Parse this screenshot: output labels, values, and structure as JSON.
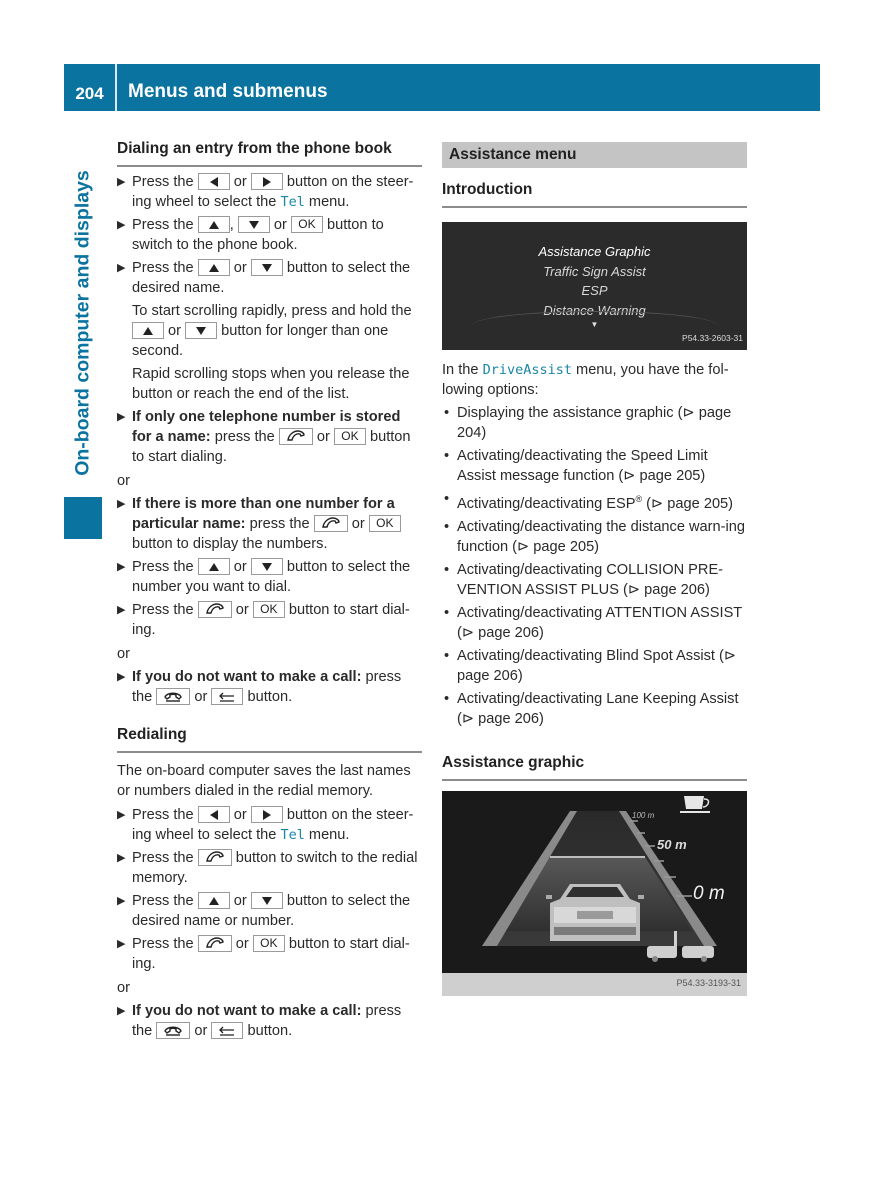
{
  "header": {
    "page_number": "204",
    "title": "Menus and submenus"
  },
  "side_tab": {
    "label": "On-board computer and displays"
  },
  "left": {
    "section1": {
      "title": "Dialing an entry from the phone book",
      "items": [
        {
          "type": "step",
          "parts": [
            "Press the ",
            "[left]",
            " or ",
            "[right]",
            " button on the steer-ing wheel to select the ",
            "{Tel}",
            " menu."
          ]
        },
        {
          "type": "step",
          "parts": [
            "Press the ",
            "[up]",
            ", ",
            "[down]",
            " or ",
            "[OK]",
            " button to switch to the phone book."
          ]
        },
        {
          "type": "step",
          "parts": [
            "Press the ",
            "[up]",
            " or ",
            "[down]",
            " button to select the desired name."
          ]
        },
        {
          "type": "note",
          "parts": [
            "To start scrolling rapidly, press and hold the ",
            "[up]",
            " or ",
            "[down]",
            " button for longer than one second."
          ]
        },
        {
          "type": "note",
          "parts": [
            "Rapid scrolling stops when you release the button or reach the end of the list."
          ]
        },
        {
          "type": "step",
          "bold": "If only one telephone number is stored for a name:",
          "parts": [
            " press the ",
            "[phone]",
            " or ",
            "[OK]",
            " button to start dialing."
          ]
        },
        {
          "type": "or",
          "text": "or"
        },
        {
          "type": "step",
          "bold": "If there is more than one number for a particular name:",
          "parts": [
            " press the ",
            "[phone]",
            " or ",
            "[OK]",
            " button to display the numbers."
          ]
        },
        {
          "type": "step",
          "parts": [
            "Press the ",
            "[up]",
            " or ",
            "[down]",
            " button to select the number you want to dial."
          ]
        },
        {
          "type": "step",
          "parts": [
            "Press the ",
            "[phone]",
            " or ",
            "[OK]",
            " button to start dial-ing."
          ]
        },
        {
          "type": "or",
          "text": "or"
        },
        {
          "type": "step",
          "bold": "If you do not want to make a call:",
          "parts": [
            " press the ",
            "[hangup]",
            " or ",
            "[back]",
            " button."
          ]
        }
      ]
    },
    "section2": {
      "title": "Redialing",
      "intro": "The on-board computer saves the last names or numbers dialed in the redial memory.",
      "items": [
        {
          "type": "step",
          "parts": [
            "Press the ",
            "[left]",
            " or ",
            "[right]",
            " button on the steer-ing wheel to select the ",
            "{Tel}",
            " menu."
          ]
        },
        {
          "type": "step",
          "parts": [
            "Press the ",
            "[phone]",
            " button to switch to the redial memory."
          ]
        },
        {
          "type": "step",
          "parts": [
            "Press the ",
            "[up]",
            " or ",
            "[down]",
            " button to select the desired name or number."
          ]
        },
        {
          "type": "step",
          "parts": [
            "Press the ",
            "[phone]",
            " or ",
            "[OK]",
            " button to start dial-ing."
          ]
        },
        {
          "type": "or",
          "text": "or"
        },
        {
          "type": "step",
          "bold": "If you do not want to make a call:",
          "parts": [
            " press the ",
            "[hangup]",
            " or ",
            "[back]",
            " button."
          ]
        }
      ]
    }
  },
  "right": {
    "bar_title": "Assistance menu",
    "intro_title": "Introduction",
    "screen1": {
      "menu_items": [
        "Assistance Graphic",
        "Traffic Sign Assist",
        "ESP",
        "Distance Warning"
      ],
      "code": "P54.33-2603-31"
    },
    "intro_text": {
      "before": "In the ",
      "menu": "DriveAssist",
      "after": " menu, you have the fol-lowing options:"
    },
    "options": [
      "Displaying the assistance graphic (⊳ page 204)",
      "Activating/deactivating the Speed Limit Assist message function (⊳ page 205)",
      "Activating/deactivating ESP® (⊳ page 205)",
      "Activating/deactivating the distance warn-ing function (⊳ page 205)",
      "Activating/deactivating COLLISION PRE-VENTION ASSIST PLUS (⊳ page 206)",
      "Activating/deactivating ATTENTION ASSIST (⊳ page 206)",
      "Activating/deactivating Blind Spot Assist (⊳ page 206)",
      "Activating/deactivating Lane Keeping Assist (⊳ page 206)"
    ],
    "graphic_title": "Assistance graphic",
    "screen2": {
      "distance_labels": [
        "100 m",
        "50 m",
        "0 m"
      ],
      "code": "P54.33-3193-31"
    }
  },
  "keys": {
    "ok": "OK"
  }
}
